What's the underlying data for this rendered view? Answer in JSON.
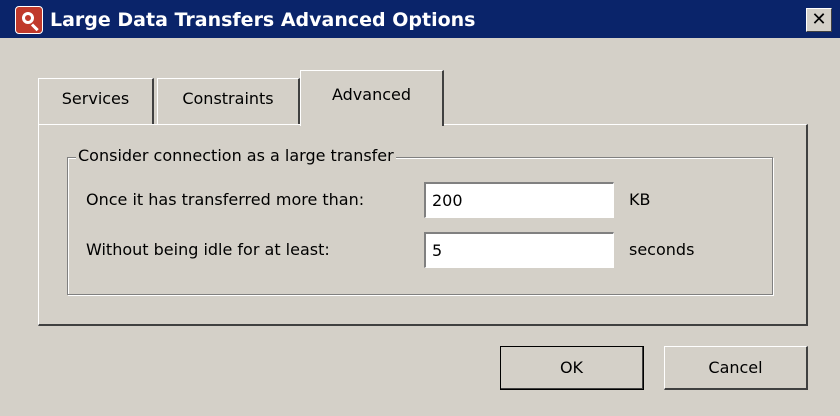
{
  "window": {
    "title": "Large Data Transfers Advanced Options",
    "close_glyph": "✕"
  },
  "icons": {
    "app": "magnifier-app-icon",
    "close": "close-icon"
  },
  "tabs": [
    {
      "label": "Services",
      "active": false
    },
    {
      "label": "Constraints",
      "active": false
    },
    {
      "label": "Advanced",
      "active": true
    }
  ],
  "group": {
    "legend": "Consider connection as a large transfer",
    "rows": [
      {
        "label": "Once it has transferred more than:",
        "value": "200",
        "unit": "KB"
      },
      {
        "label": "Without being idle for at least:",
        "value": "5",
        "unit": "seconds"
      }
    ]
  },
  "buttons": {
    "ok": "OK",
    "cancel": "Cancel"
  },
  "colors": {
    "titlebar": "#0a246a",
    "window_bg": "#d4d0c8",
    "app_icon": "#c0392b"
  }
}
